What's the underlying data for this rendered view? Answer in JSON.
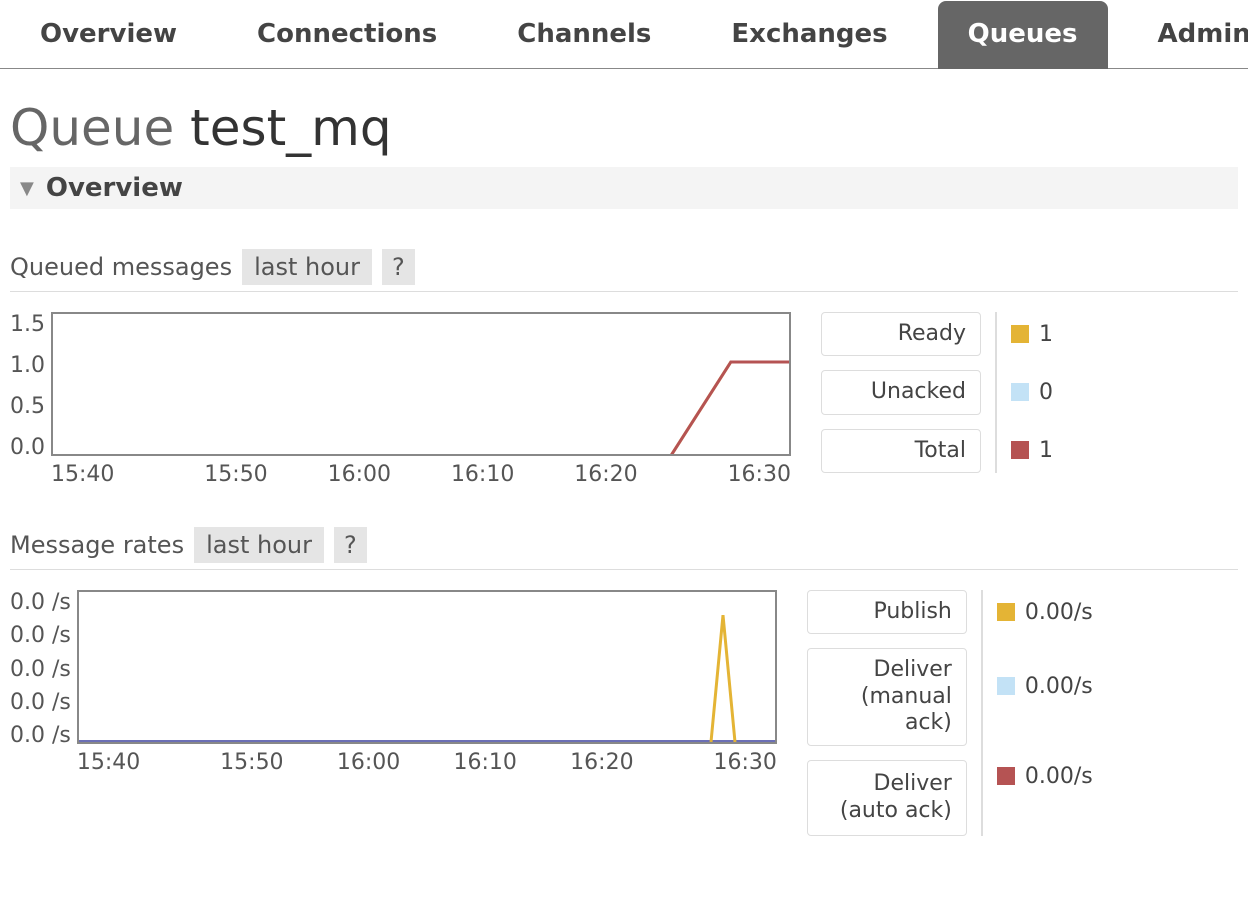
{
  "tabs": {
    "overview": {
      "label": "Overview",
      "active": false
    },
    "connections": {
      "label": "Connections",
      "active": false
    },
    "channels": {
      "label": "Channels",
      "active": false
    },
    "exchanges": {
      "label": "Exchanges",
      "active": false
    },
    "queues": {
      "label": "Queues",
      "active": true
    },
    "admin": {
      "label": "Admin",
      "active": false
    }
  },
  "page": {
    "title_prefix": "Queue ",
    "title_name": "test_mq"
  },
  "section": {
    "overview_label": "Overview"
  },
  "colors": {
    "ready": "#e4b435",
    "unacked": "#c3e2f6",
    "total": "#b55353",
    "publish": "#e4b435",
    "deliver_m": "#c3e2f6",
    "deliver_a": "#b55353",
    "rates_base": "#6b6fb5"
  },
  "queued": {
    "title": "Queued messages",
    "range_label": "last hour",
    "help_label": "?",
    "legend": {
      "ready": {
        "label": "Ready",
        "value": "1"
      },
      "unacked": {
        "label": "Unacked",
        "value": "0"
      },
      "total": {
        "label": "Total",
        "value": "1"
      }
    }
  },
  "rates": {
    "title": "Message rates",
    "range_label": "last hour",
    "help_label": "?",
    "legend": {
      "publish": {
        "label": "Publish",
        "value": "0.00/s"
      },
      "deliver_m": {
        "label": "Deliver (manual ack)",
        "value": "0.00/s"
      },
      "deliver_a": {
        "label": "Deliver (auto ack)",
        "value": "0.00/s"
      }
    }
  },
  "chart_data": [
    {
      "id": "queued",
      "type": "line",
      "title": "Queued messages (last hour)",
      "xlabel": "",
      "ylabel": "",
      "x_ticks": [
        "15:40",
        "15:50",
        "16:00",
        "16:10",
        "16:20",
        "16:30"
      ],
      "y_ticks": [
        "0.0",
        "0.5",
        "1.0",
        "1.5"
      ],
      "ylim": [
        0,
        1.5
      ],
      "series": [
        {
          "name": "Ready",
          "color": "#e4b435",
          "values": [
            0,
            0,
            0,
            0,
            0,
            0,
            0,
            0,
            0,
            0,
            0,
            1,
            1
          ]
        },
        {
          "name": "Unacked",
          "color": "#c3e2f6",
          "values": [
            0,
            0,
            0,
            0,
            0,
            0,
            0,
            0,
            0,
            0,
            0,
            0,
            0
          ]
        },
        {
          "name": "Total",
          "color": "#b55353",
          "values": [
            0,
            0,
            0,
            0,
            0,
            0,
            0,
            0,
            0,
            0,
            0,
            1,
            1
          ]
        }
      ],
      "x_fractions": [
        0.0,
        0.083,
        0.166,
        0.25,
        0.333,
        0.416,
        0.5,
        0.583,
        0.666,
        0.75,
        0.833,
        0.916,
        1.0
      ]
    },
    {
      "id": "rates",
      "type": "line",
      "title": "Message rates (last hour)",
      "xlabel": "",
      "ylabel": "/s",
      "x_ticks": [
        "15:40",
        "15:50",
        "16:00",
        "16:10",
        "16:20",
        "16:30"
      ],
      "y_ticks": [
        "0.0 /s",
        "0.0 /s",
        "0.0 /s",
        "0.0 /s",
        "0.0 /s"
      ],
      "ylim": [
        0,
        1
      ],
      "series": [
        {
          "name": "Publish",
          "color": "#e4b435",
          "spike_at": 0.92
        },
        {
          "name": "Deliver (manual ack)",
          "color": "#c3e2f6",
          "spike_at": null
        },
        {
          "name": "Deliver (auto ack)",
          "color": "#b55353",
          "spike_at": null
        },
        {
          "name": "baseline",
          "color": "#6b6fb5",
          "spike_at": null
        }
      ]
    }
  ]
}
